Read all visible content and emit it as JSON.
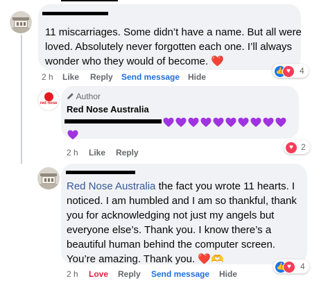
{
  "comments": [
    {
      "text_lines": [
        "11 miscarriages. Some didn’t have a name. But all were",
        "loved. Absolutely never forgotten each one. I’ll always",
        "wonder who they would of become."
      ],
      "trailing_emoji": "❤️",
      "time": "2 h",
      "actions": [
        "Like",
        "Reply",
        "Send message",
        "Hide"
      ],
      "reaction_count": "4"
    },
    {
      "author_badge": "Author",
      "author_name": "Red Nose Australia",
      "avatar_text": "red nose",
      "emoji": "💜💜💜💜💜💜💜💜💜💜💜",
      "time": "2 h",
      "actions": [
        "Like",
        "Reply"
      ],
      "reaction_count": "2"
    },
    {
      "mention": "Red Nose Australia",
      "first_line_rest": " the fact you wrote 11 hearts. I",
      "text_lines": [
        "noticed. I am humbled and I am so thankful, thank",
        "you for acknowledging not just my angels but",
        "everyone else’s. Thank you. I know there’s a",
        "beautiful human behind the computer screen.",
        "You’re amazing. Thank you."
      ],
      "trailing_emoji": "❤️🫶",
      "time": "2 h",
      "actions": [
        "Love",
        "Reply",
        "Send message",
        "Hide"
      ],
      "reaction_count": "4"
    }
  ],
  "colors": {
    "link_blue": "#216fdb",
    "love_red": "#e41e3f",
    "purple_heart": "#a033e0",
    "bubble": "#f0f2f5"
  },
  "icons": [
    "like-reaction-icon",
    "love-reaction-icon",
    "pencil-icon",
    "heart-icon",
    "purple-heart-icon",
    "heart-hands-icon"
  ]
}
